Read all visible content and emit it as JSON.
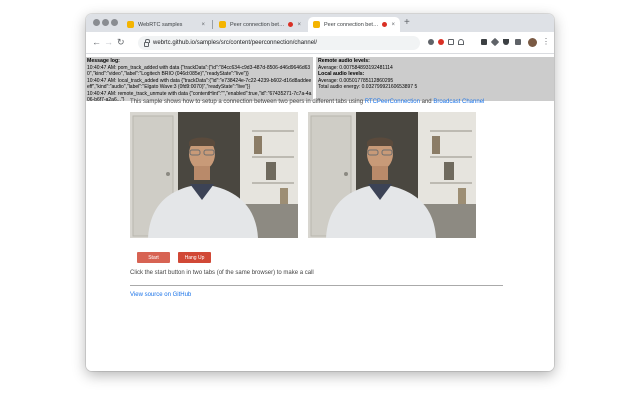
{
  "browser": {
    "tabs": [
      {
        "title": "WebRTC samples",
        "active": false,
        "recording": false,
        "favicon_color": "#f4b400"
      },
      {
        "title": "Peer connection between",
        "active": false,
        "recording": true,
        "favicon_color": "#f4b400"
      },
      {
        "title": "Peer connection between",
        "active": true,
        "recording": true,
        "favicon_color": "#f4b400"
      }
    ],
    "close_glyph": "×",
    "new_tab_glyph": "+",
    "url": "webrtc.github.io/samples/src/content/peerconnection/channel/",
    "nav": {
      "back": "←",
      "forward": "→",
      "reload": "↻"
    },
    "menu_glyph": "⋮"
  },
  "page": {
    "log": {
      "title": "Message log:",
      "lines": [
        "10:40:47 AM: pom_track_added with data {\"trackData\":{\"id\":\"84cc634-c9d3-487d-8506-d46d9646d630\",\"kind\":\"video\",\"label\":\"Logitech BRIO (046d:085e)\",\"readyState\":\"live\"}}",
        "10:40:47 AM: local_track_added with data {\"trackData\":{\"id\":\"e738424e-7c22-4239-b602-d16d8addeeeff\",\"kind\":\"audio\",\"label\":\"Elgato Wave:3 (0fd9:0070)\",\"readyState\":\"live\"}}",
        "10:40:47 AM: remote_track_unmute with data {\"contentHint\":\"\",\"enabled\":true,\"id\":\"67435271-7c7a-4a06-b6f7-a2a6...\"}"
      ]
    },
    "audio": {
      "remote_title": "Remote audio levels:",
      "remote_average": "Average: 0.007584893192481114",
      "local_title": "Local audio levels:",
      "local_average": "Average: 0.005017785112860295",
      "local_total": "Total audio energy: 0.03279992160653897 5"
    },
    "description": {
      "prefix": "This sample shows how to setup a connection between two peers in different tabs using ",
      "link1": "RTCPeerConnection",
      "middle": " and ",
      "link2": "Broadcast Channel"
    },
    "buttons": {
      "start": "Start",
      "hangup": "Hang Up"
    },
    "instructions": "Click the start button in two tabs (of the same browser) to make a call",
    "source_link": "View source on GitHub"
  },
  "colors": {
    "button": "#d14836",
    "link": "#1a73e8",
    "panel": "#cccccc",
    "tabstrip": "#dee1e6"
  }
}
